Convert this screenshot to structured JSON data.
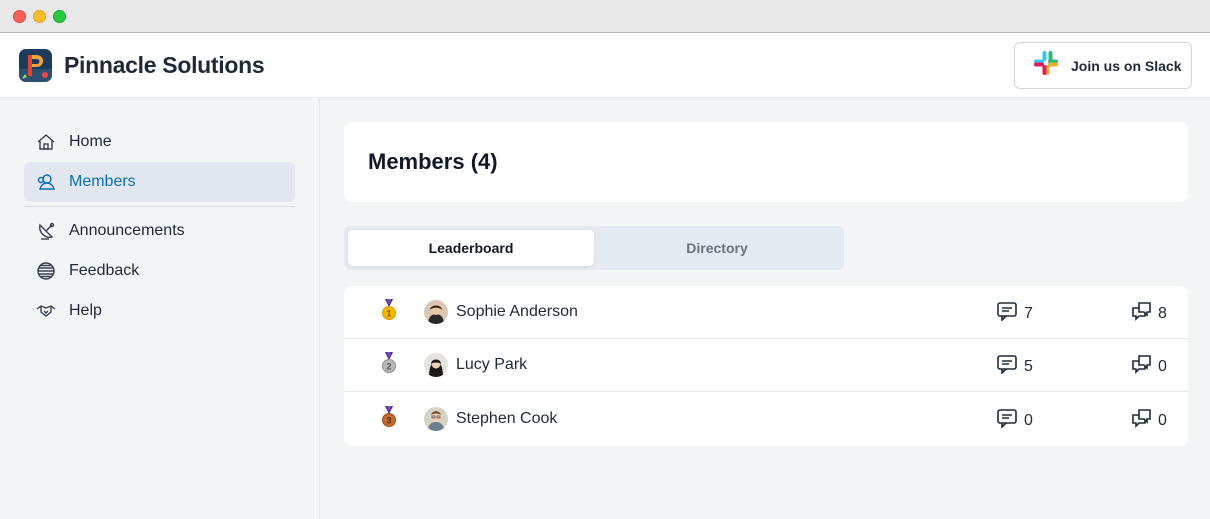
{
  "window": {
    "controls": [
      "close",
      "minimize",
      "maximize"
    ]
  },
  "header": {
    "brand": "Pinnacle Solutions",
    "slack_label": "Join us on Slack",
    "logo_icon": "pinnacle-logo-icon"
  },
  "sidebar": {
    "items": [
      {
        "label": "Home",
        "icon": "house-icon",
        "active": false
      },
      {
        "label": "Members",
        "icon": "members-icon",
        "active": true
      },
      {
        "label": "Announcements",
        "icon": "satellite-icon",
        "active": false
      },
      {
        "label": "Feedback",
        "icon": "globe-icon",
        "active": false
      },
      {
        "label": "Help",
        "icon": "handshake-icon",
        "active": false
      }
    ]
  },
  "main": {
    "title": "Members (4)",
    "tabs": [
      {
        "label": "Leaderboard",
        "selected": true
      },
      {
        "label": "Directory",
        "selected": false
      }
    ],
    "members": [
      {
        "rank": 1,
        "medal": "gold-medal-icon",
        "name": "Sophie Anderson",
        "comments": "7",
        "threads": "8"
      },
      {
        "rank": 2,
        "medal": "silver-medal-icon",
        "name": "Lucy Park",
        "comments": "5",
        "threads": "0"
      },
      {
        "rank": 3,
        "medal": "bronze-medal-icon",
        "name": "Stephen Cook",
        "comments": "0",
        "threads": "0"
      }
    ]
  },
  "colors": {
    "accent": "#0b6fb5",
    "active_bg": "#e2e7ef",
    "gold": "#f5b800",
    "silver": "#a9a9a9",
    "bronze": "#c46a2b"
  }
}
